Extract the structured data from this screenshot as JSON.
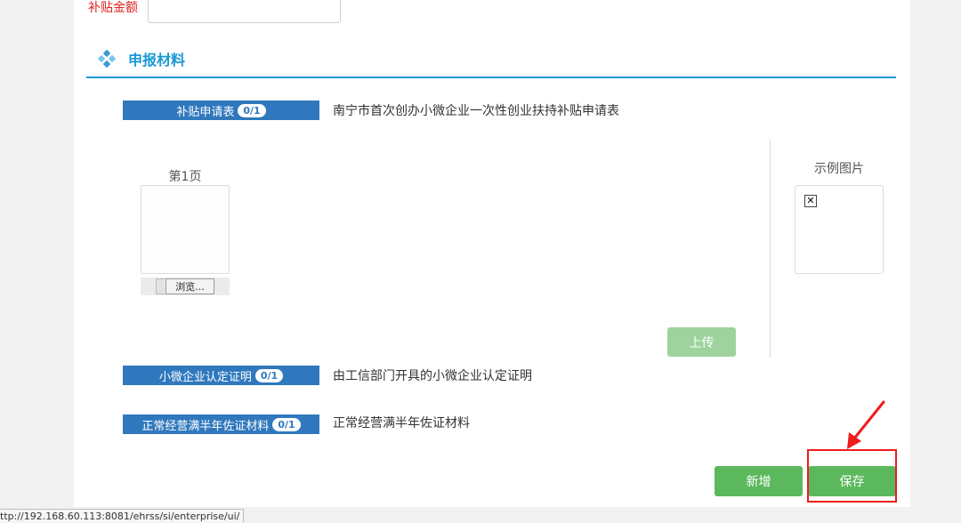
{
  "form": {
    "subsidy_amount_label": "补贴金额",
    "subsidy_amount_value": ""
  },
  "section": {
    "title": "申报材料"
  },
  "materials": [
    {
      "tag": "补贴申请表",
      "count": "0/1",
      "description": "南宁市首次创办小微企业一次性创业扶持补贴申请表"
    },
    {
      "tag": "小微企业认定证明",
      "count": "0/1",
      "description": "由工信部门开具的小微企业认定证明"
    },
    {
      "tag": "正常经营满半年佐证材料",
      "count": "0/1",
      "description": "正常经营满半年佐证材料"
    }
  ],
  "upload": {
    "page_label": "第1页",
    "browse_label": "浏览...",
    "example_label": "示例图片",
    "upload_button": "上传"
  },
  "actions": {
    "add_label": "新增",
    "save_label": "保存"
  },
  "status_bar": {
    "url": "ttp://192.168.60.113:8081/ehrss/si/enterprise/ui/"
  },
  "colors": {
    "accent": "#1a98d5",
    "tag_bg": "#2f78bd",
    "success": "#5cb85c",
    "highlight": "#ee1c1c"
  }
}
